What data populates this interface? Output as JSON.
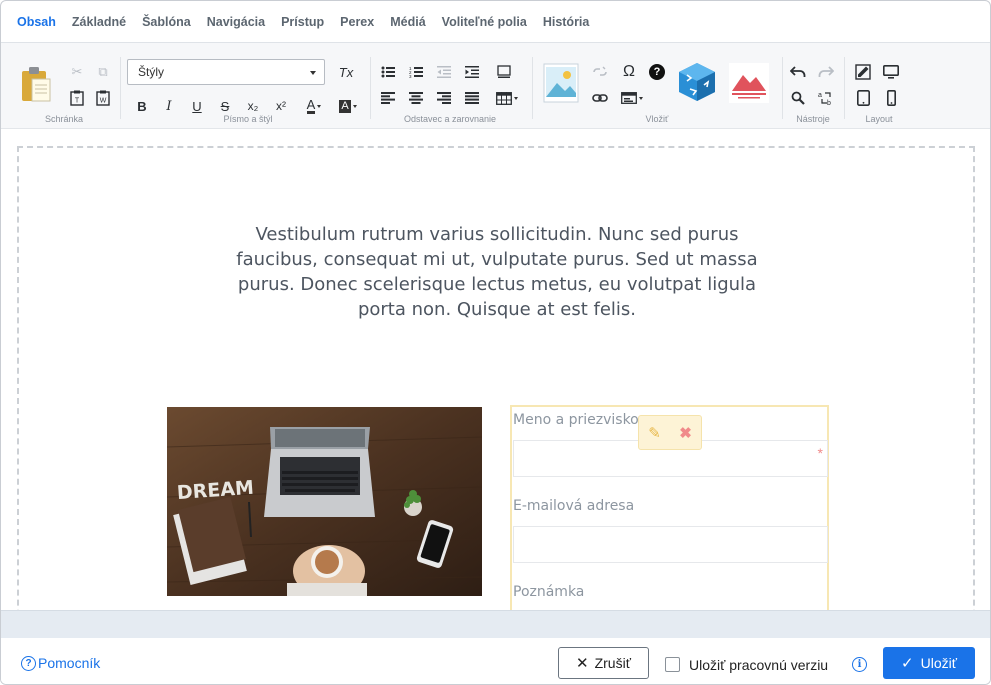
{
  "tabs": [
    {
      "label": "Obsah",
      "active": true
    },
    {
      "label": "Základné"
    },
    {
      "label": "Šablóna"
    },
    {
      "label": "Navigácia"
    },
    {
      "label": "Prístup"
    },
    {
      "label": "Perex"
    },
    {
      "label": "Médiá"
    },
    {
      "label": "Voliteľné polia"
    },
    {
      "label": "História"
    }
  ],
  "toolbar": {
    "groups": {
      "clipboard": "Schránka",
      "font": "Písmo a štýl",
      "paragraph": "Odstavec a zarovnanie",
      "insert": "Vložiť",
      "tools": "Nástroje",
      "layout": "Layout"
    },
    "styles_select": "Štýly",
    "icons": {
      "bold": "B",
      "italic": "I",
      "underline": "U",
      "strike": "S",
      "subscript": "x₂",
      "superscript": "x²",
      "text_color": "A",
      "bg_color": "A",
      "omega": "Ω",
      "help": "?",
      "remove_format": "Tx"
    }
  },
  "editor": {
    "paragraph": "Vestibulum rutrum varius sollicitudin. Nunc sed purus faucibus, consequat mi ut, vulputate purus. Sed ut massa purus. Donec scelerisque lectus metus, eu volutpat ligula porta non. Quisque at est felis.",
    "form": {
      "name_label": "Meno a priezvisko",
      "required_mark": "*",
      "email_label": "E-mailová adresa",
      "note_label": "Poznámka"
    },
    "photo_text": "DREAM"
  },
  "footer": {
    "help_label": "Pomocník",
    "cancel_label": "Zrušiť",
    "checkbox_label": "Uložiť pracovnú verziu",
    "save_label": "Uložiť"
  },
  "colors": {
    "accent": "#1a73e8",
    "form_border": "#f7e7b3",
    "widget_tools_bg": "#fdf3d6"
  }
}
